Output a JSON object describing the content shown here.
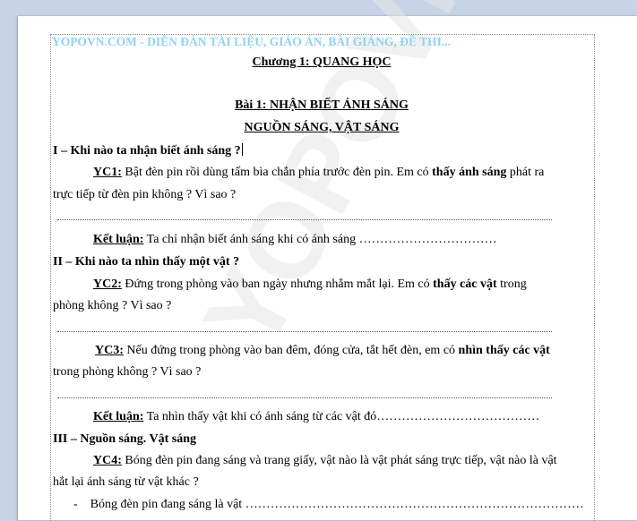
{
  "header_text": "YOPOVN.COM - DIỄN ĐÀN TÀI LIỆU, GIÁO ÁN, BÀI GIẢNG, ĐỀ THI...",
  "watermark": "YOPOVN.COM",
  "chapter": "Chương 1: QUANG HỌC",
  "lesson_title": "Bài 1: NHẬN BIẾT ÁNH SÁNG",
  "lesson_subtitle": "NGUỒN SÁNG, VẬT SÁNG",
  "sec1": {
    "heading": "I – Khi nào ta nhận biết ánh sáng ?",
    "yc_label": "YC1:",
    "yc_text1": " Bật đèn pin rồi dùng tấm bìa chắn phía trước đèn pin. Em có ",
    "yc_bold": "thấy ánh sáng",
    "yc_text2": " phát ra",
    "yc_line2": "trực tiếp từ đèn pin không ? Vì sao ?",
    "kl_label": "Kết luận:",
    "kl_text": " Ta chỉ nhận biết ánh sáng khi có ánh sáng ……………………………"
  },
  "sec2": {
    "heading": "II – Khi nào ta nhìn thấy một vật ?",
    "yc2_label": "YC2:",
    "yc2_text1": " Đứng trong phòng vào ban ngày nhưng nhắm mắt lại. Em có ",
    "yc2_bold": "thấy các vật",
    "yc2_text2": " trong",
    "yc2_line2": "phòng không ? Vì sao ?",
    "yc3_label": "YC3:",
    "yc3_text1": " Nếu đứng trong phòng vào ban đêm, đóng cửa, tắt hết đèn, em có ",
    "yc3_bold": "nhìn thấy các vật",
    "yc3_line2": "trong phòng không ? Vì sao ?",
    "kl_label": "Kết luận:",
    "kl_text": " Ta nhìn thấy vật khi có ánh sáng từ các vật đó…………………………………"
  },
  "sec3": {
    "heading": "III – Nguồn sáng. Vật sáng",
    "yc4_label": "YC4:",
    "yc4_text1": " Bóng đèn pin đang sáng và trang giấy, vật nào là vật phát sáng trực tiếp, vật nào là vật",
    "yc4_line2": "hắt lại ánh sáng từ vật khác ?",
    "bullet_dash": "-",
    "bullet_text": "Bóng đèn pin đang sáng là vật ………………………………………………………………………"
  }
}
